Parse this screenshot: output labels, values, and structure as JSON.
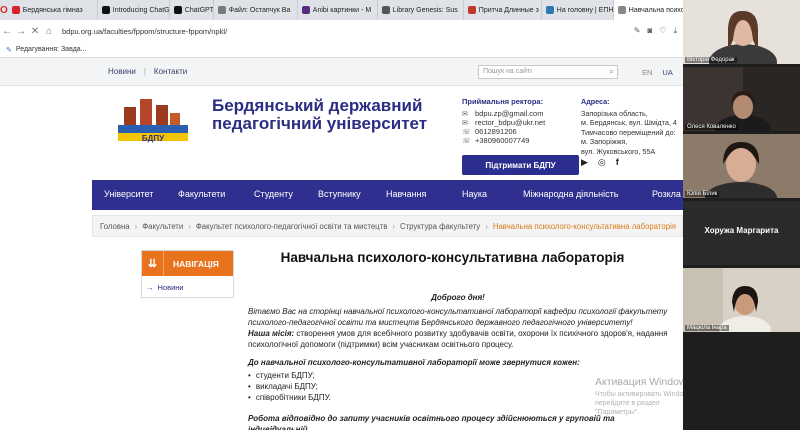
{
  "browser": {
    "tabs": [
      {
        "label": "Бердянська гімназ",
        "color": "#d9232e"
      },
      {
        "label": "Introducing ChatGP",
        "color": "#111111"
      },
      {
        "label": "ChatGPT",
        "color": "#111111"
      },
      {
        "label": "Файл: Остапчук Ва",
        "color": "#7a7a7a"
      },
      {
        "label": "Anibi картинки - M",
        "color": "#5a2d82"
      },
      {
        "label": "Library Genesis: Sus",
        "color": "#555555"
      },
      {
        "label": "Притча Длинные з",
        "color": "#c0392b"
      },
      {
        "label": "На головну | ЕПН Б",
        "color": "#2a7ab8"
      },
      {
        "label": "Навчальна психоло",
        "color": "#888888",
        "active": true
      }
    ],
    "url": "bdpu.org.ua/faculties/fppom/structure-fppom/npkl/",
    "bookmark": "Редагування: Завда..."
  },
  "site": {
    "toplinks": {
      "news": "Новини",
      "contacts": "Контакти"
    },
    "search_placeholder": "Пошук на сайті",
    "langs": {
      "en": "EN",
      "ua": "UA"
    },
    "university_name": "Бердянський державний педагогічний університет",
    "logo_text": "БДПУ",
    "rector": {
      "title": "Приймальня ректора:",
      "email1": "bdpu.zp@gmail.com",
      "email2": "rector_bdpu@ukr.net",
      "phone1": "0612891206",
      "phone2": "+380960007749"
    },
    "support_button": "Підтримати БДПУ",
    "address": {
      "title": "Адреса:",
      "line1": "Запорізька область,",
      "line2": "м. Бердянськ, вул. Шмідта, 4",
      "line3": "Тимчасово переміщений до:",
      "line4": "м. Запоріжжя,",
      "line5": "вул. Жуковського, 55А"
    },
    "nav": [
      "Університет",
      "Факультети",
      "Студенту",
      "Вступнику",
      "Навчання",
      "Наука",
      "Міжнародна діяльність",
      "Розкла"
    ],
    "breadcrumbs": [
      "Головна",
      "Факультети",
      "Факультет психолого-педагогічної освіти та мистецтв",
      "Структура факультету",
      "Навчальна психолого-консультативна лабораторія"
    ],
    "sidebar": {
      "heading": "НАВІГАЦІЯ",
      "item": "Новини"
    },
    "page_title": "Навчальна психолого-консультативна лабораторія",
    "content": {
      "greeting": "Доброго дня!",
      "intro": "Вітаємо Вас на сторінці навчальної психолого-консультативної лабораторії кафедри психології факультету психолого-педагогічної освіти та мистецтв Бердянського державного педагогічного університету!",
      "mission_label": "Наша місія:",
      "mission_text": " створення умов для всебічного розвитку здобувачів освіти, охорони їх психічного здоров'я, надання психологічної допомоги (підтримки) всім учасникам освітнього процесу.",
      "who_heading": "До навчальної психолого-консультативної лабораторії може звернутися кожен:",
      "who_list": [
        "студенти БДПУ;",
        "викладачі БДПУ;",
        "співробітники БДПУ."
      ],
      "work_text": "Робота відповідно до запиту учасників освітнього процесу здійснюються у груповій та індивідуальній"
    },
    "watermark": {
      "title": "Активация Windows",
      "text": "Чтобы активировать Windows, перейдите в раздел \"Параметры\"."
    }
  },
  "participants": [
    {
      "name": "Вікторія Федорак"
    },
    {
      "name": "Олеся Коваленко"
    },
    {
      "name": "Юлія Білик"
    },
    {
      "name": "Хоружа Маргарита",
      "no_video": true
    },
    {
      "name": "Мацюла Інара"
    }
  ]
}
